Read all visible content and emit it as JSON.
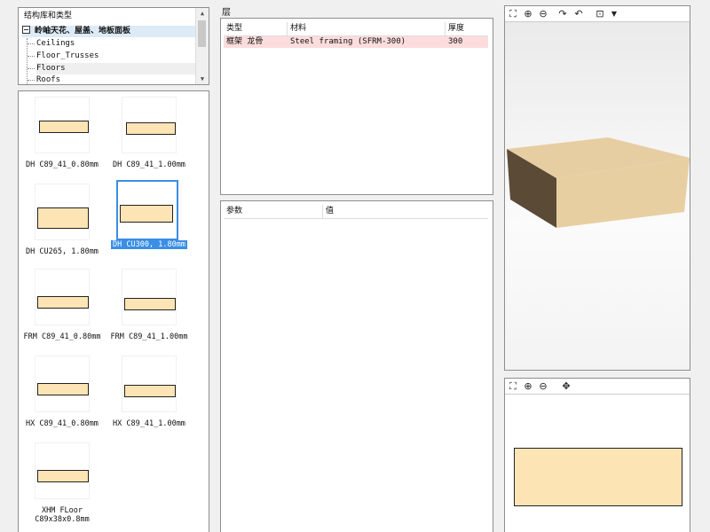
{
  "tree": {
    "title": "结构库和类型",
    "root": "岭岫天花、屋盖、地板面板",
    "children": [
      "Ceilings",
      "Floor_Trusses",
      "Floors",
      "Roofs"
    ],
    "selected_child": "Floors"
  },
  "library": {
    "tiles": [
      {
        "label": "DH C89_41_0.80mm"
      },
      {
        "label": "DH C89_41_1.00mm"
      },
      {
        "label": "DH CU265, 1.80mm"
      },
      {
        "label": "DH CU300, 1.80mm",
        "selected": true
      },
      {
        "label": "FRM C89_41_0.80mm"
      },
      {
        "label": "FRM C89_41_1.00mm"
      },
      {
        "label": "HX C89_41_0.80mm"
      },
      {
        "label": "HX C89_41_1.00mm"
      },
      {
        "label": "XHM FLoor\nC89x38x0.8mm"
      }
    ]
  },
  "layers": {
    "title": "层",
    "columns": [
      "类型",
      "材料",
      "厚度"
    ],
    "rows": [
      {
        "type": "框架 龙骨",
        "material": "Steel framing (SFRM-300)",
        "thickness": "300"
      }
    ]
  },
  "params": {
    "columns": [
      "参数",
      "值"
    ]
  },
  "colors": {
    "selection_blue": "#3a8ee6",
    "profile_fill": "#fde4b4",
    "layer_row_bg": "#fcdcdc"
  },
  "toolbar3d": [
    "fit-extents-icon",
    "zoom-in-icon",
    "zoom-out-icon",
    "rotate-left-icon",
    "rotate-right-icon",
    "view-cube-icon",
    "dropdown-icon"
  ],
  "toolbar2d": [
    "fit-extents-icon",
    "zoom-in-icon",
    "zoom-out-icon",
    "pan-icon"
  ]
}
